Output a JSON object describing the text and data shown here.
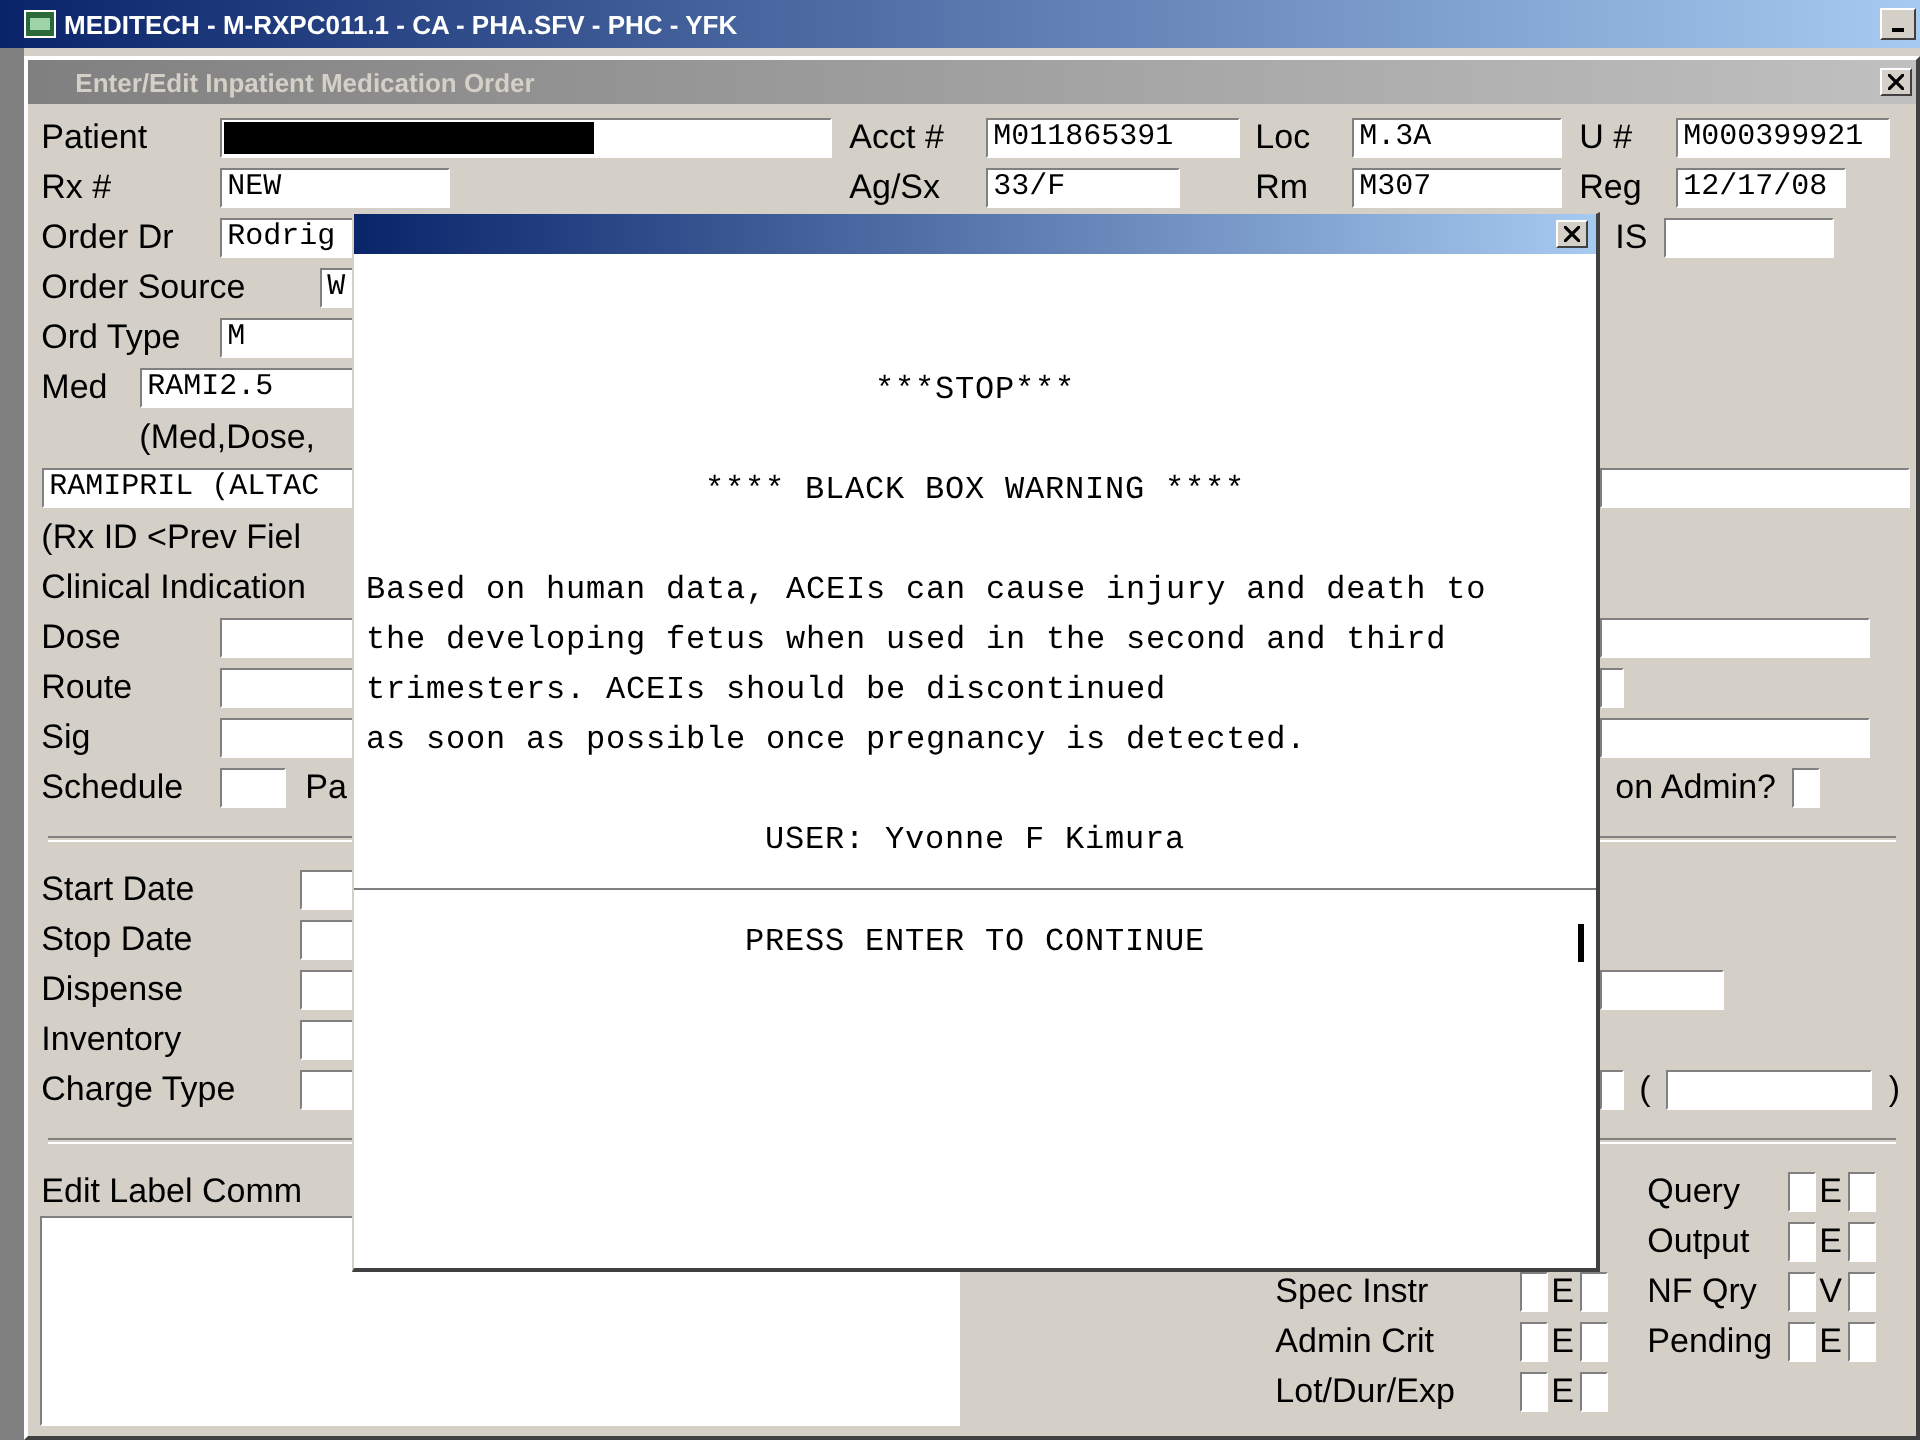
{
  "window": {
    "title": "MEDITECH - M-RXPC011.1 - CA - PHA.SFV - PHC - YFK"
  },
  "form": {
    "title": "Enter/Edit Inpatient Medication Order",
    "header_rows": [
      [
        {
          "kind": "label",
          "text": "Patient"
        },
        {
          "kind": "field",
          "redacted": true
        },
        {
          "kind": "label",
          "text": "Acct #"
        },
        {
          "kind": "field",
          "value": "M011865391"
        },
        {
          "kind": "label",
          "text": "Loc"
        },
        {
          "kind": "field",
          "value": "M.3A"
        },
        {
          "kind": "label",
          "text": "U #"
        },
        {
          "kind": "field",
          "value": "M000399921"
        }
      ],
      [
        {
          "kind": "label",
          "text": "Rx #"
        },
        {
          "kind": "field",
          "value": "NEW"
        },
        {
          "kind": "label",
          "text": "Ag/Sx"
        },
        {
          "kind": "field",
          "value": "33/F"
        },
        {
          "kind": "label",
          "text": "Rm"
        },
        {
          "kind": "field",
          "value": "M307"
        },
        {
          "kind": "label",
          "text": "Reg"
        },
        {
          "kind": "field",
          "value": "12/17/08"
        }
      ]
    ],
    "sections": [
      [
        {
          "left": [
            {
              "kind": "label",
              "text": "Order Dr"
            },
            {
              "kind": "field",
              "value": "Rodrig"
            }
          ],
          "right": [
            {
              "kind": "label",
              "text": "IS"
            },
            {
              "kind": "field"
            }
          ]
        },
        {
          "left": [
            {
              "kind": "label",
              "text": "Order Source"
            },
            {
              "kind": "field",
              "value": "W"
            }
          ]
        },
        {
          "left": [
            {
              "kind": "label",
              "text": "Ord Type"
            },
            {
              "kind": "field",
              "value": "M"
            }
          ]
        },
        {
          "left": [
            {
              "kind": "label",
              "text": "Med"
            },
            {
              "kind": "field",
              "value": "RAMI2.5"
            }
          ]
        },
        {
          "left": [
            {
              "kind": "note",
              "text": "(Med,Dose,"
            }
          ]
        },
        {
          "left": [
            {
              "kind": "field",
              "value": "RAMIPRIL (ALTAC"
            }
          ],
          "right": [
            {
              "kind": "field"
            }
          ]
        },
        {
          "left": [
            {
              "kind": "label",
              "text": "(Rx ID <Prev Fiel"
            }
          ]
        },
        {
          "left": [
            {
              "kind": "label",
              "text": "Clinical Indication"
            }
          ]
        },
        {
          "left": [
            {
              "kind": "label",
              "text": "Dose"
            },
            {
              "kind": "field"
            }
          ],
          "right": [
            {
              "kind": "field"
            }
          ]
        },
        {
          "left": [
            {
              "kind": "label",
              "text": "Route"
            },
            {
              "kind": "field"
            }
          ],
          "right": [
            {
              "kind": "field"
            }
          ]
        },
        {
          "left": [
            {
              "kind": "label",
              "text": "Sig"
            },
            {
              "kind": "field"
            }
          ],
          "right": [
            {
              "kind": "field"
            }
          ]
        },
        {
          "left": [
            {
              "kind": "label",
              "text": "Schedule"
            },
            {
              "kind": "field"
            },
            {
              "kind": "label",
              "text": "Pa"
            }
          ],
          "right": [
            {
              "kind": "label",
              "text": "on Admin?"
            },
            {
              "kind": "checkbox",
              "checked": false
            }
          ]
        }
      ],
      [
        {
          "left": [
            {
              "kind": "label",
              "text": "Start Date"
            },
            {
              "kind": "field"
            }
          ]
        },
        {
          "left": [
            {
              "kind": "label",
              "text": "Stop Date"
            },
            {
              "kind": "field"
            }
          ]
        },
        {
          "left": [
            {
              "kind": "label",
              "text": "Dispense"
            },
            {
              "kind": "field"
            }
          ],
          "right": [
            {
              "kind": "field"
            }
          ]
        },
        {
          "left": [
            {
              "kind": "label",
              "text": "Inventory"
            },
            {
              "kind": "field"
            }
          ]
        },
        {
          "left": [
            {
              "kind": "label",
              "text": "Charge Type"
            },
            {
              "kind": "field"
            }
          ],
          "right": [
            {
              "kind": "field"
            },
            {
              "kind": "label",
              "text": "("
            },
            {
              "kind": "field"
            },
            {
              "kind": "label",
              "text": ")"
            }
          ]
        }
      ]
    ],
    "comment_label": "Edit Label Comm",
    "flags_a": [
      {
        "label": "Spec Instr",
        "letter": "E",
        "boxes": [
          {
            "checked": false
          },
          {
            "checked": false
          }
        ]
      },
      {
        "label": "Admin Crit",
        "letter": "E",
        "boxes": [
          {
            "checked": false
          },
          {
            "checked": false
          }
        ]
      },
      {
        "label": "Lot/Dur/Exp",
        "letter": "E",
        "boxes": [
          {
            "checked": false
          },
          {
            "checked": false
          }
        ]
      }
    ],
    "flags_b": [
      {
        "label": "Query",
        "letter": "E",
        "boxes": [
          {
            "checked": false
          },
          {
            "checked": false
          }
        ]
      },
      {
        "label": "Output",
        "letter": "E",
        "boxes": [
          {
            "checked": false
          },
          {
            "checked": false
          }
        ]
      },
      {
        "label": "NF Qry",
        "letter": "V",
        "boxes": [
          {
            "checked": false
          },
          {
            "checked": false
          }
        ]
      },
      {
        "label": "Pending",
        "letter": "E",
        "boxes": [
          {
            "checked": false
          },
          {
            "checked": false
          }
        ]
      }
    ]
  },
  "dialog": {
    "heading": "***STOP***",
    "subheading": "**** BLACK BOX WARNING ****",
    "message": "Based on human data, ACEIs can cause injury and death to\nthe developing fetus when used in the second and third\ntrimesters. ACEIs should be discontinued\nas soon as possible once pregnancy is detected.",
    "user": "USER: Yvonne F Kimura",
    "prompt": "PRESS ENTER TO CONTINUE"
  }
}
